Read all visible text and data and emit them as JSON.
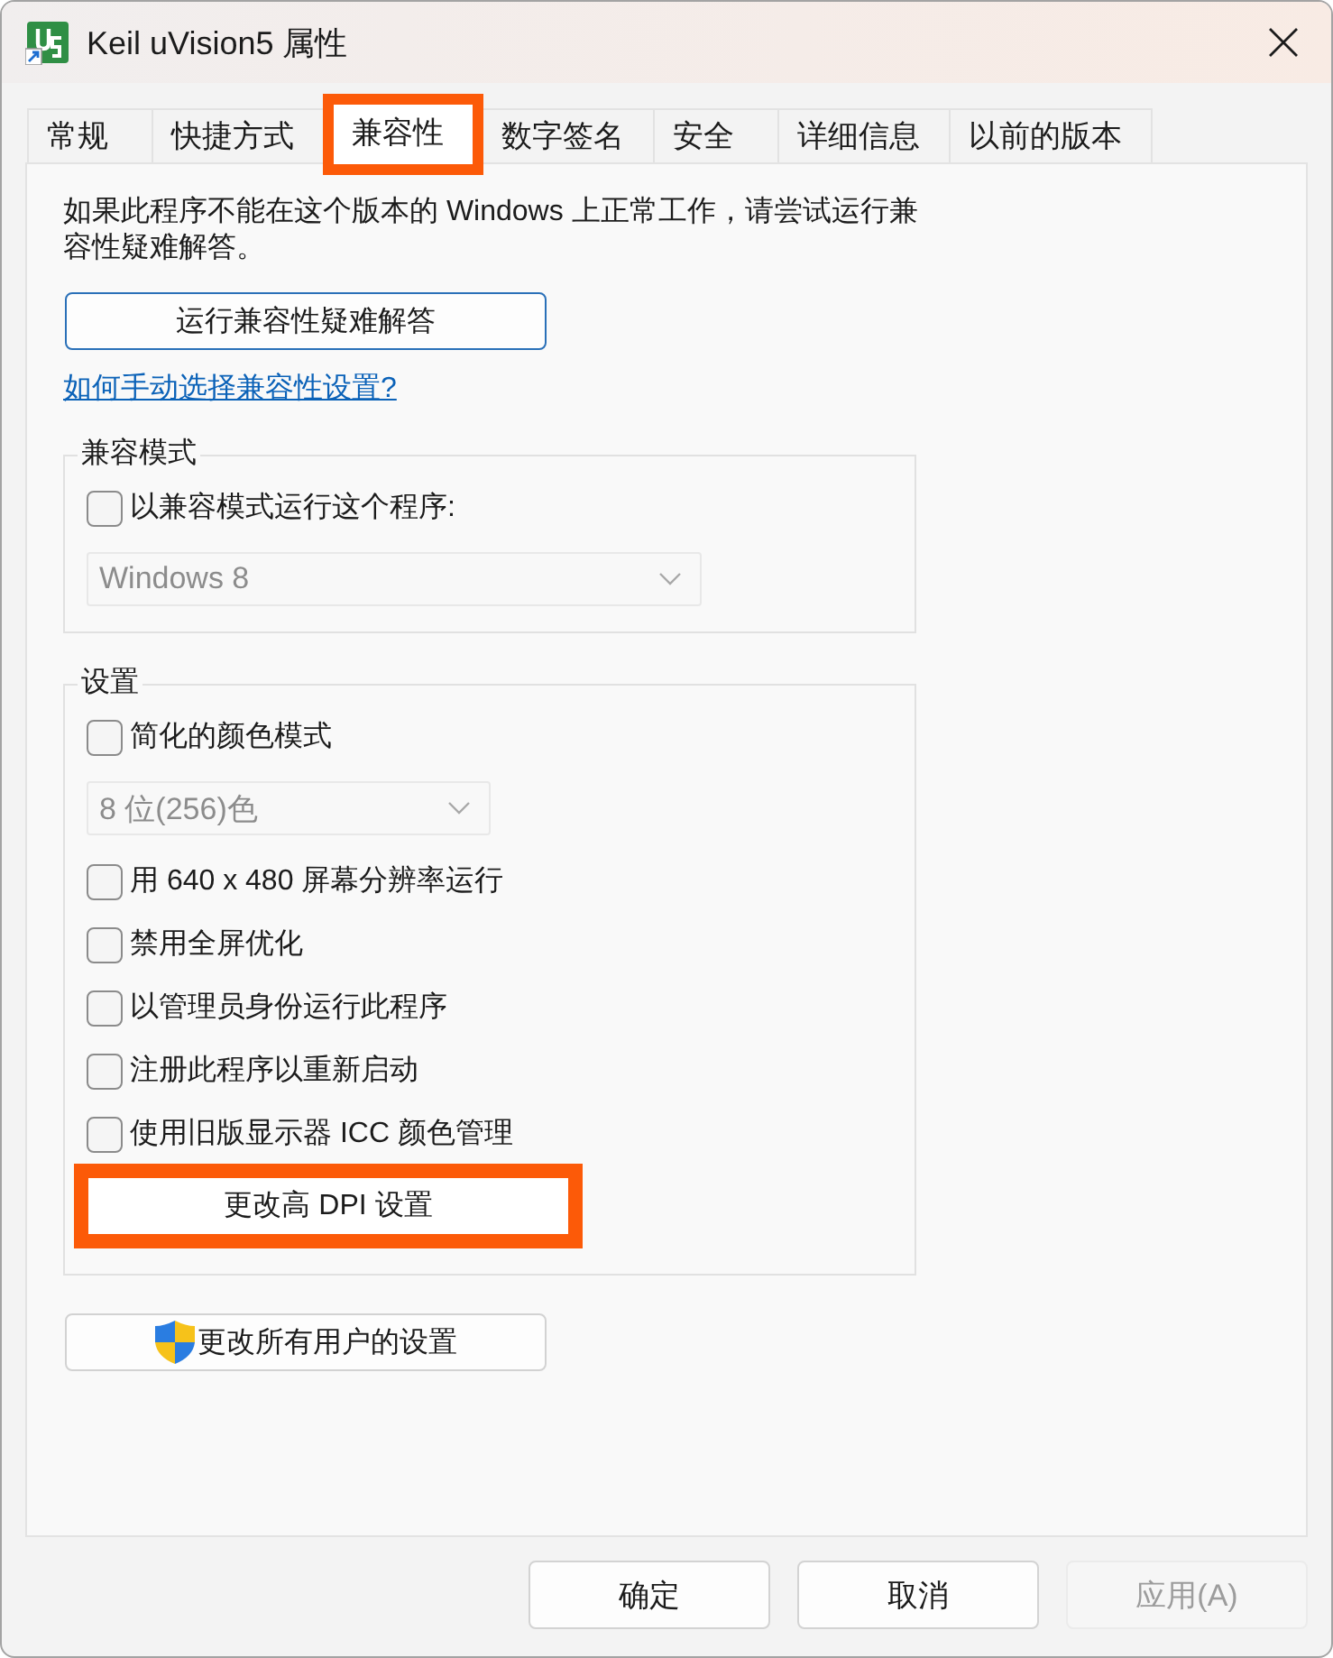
{
  "window": {
    "title": "Keil uVision5 属性"
  },
  "tabs": [
    {
      "label": "常规",
      "selected": false,
      "highlighted": false
    },
    {
      "label": "快捷方式",
      "selected": false,
      "highlighted": false
    },
    {
      "label": "兼容性",
      "selected": true,
      "highlighted": true
    },
    {
      "label": "数字签名",
      "selected": false,
      "highlighted": false
    },
    {
      "label": "安全",
      "selected": false,
      "highlighted": false
    },
    {
      "label": "详细信息",
      "selected": false,
      "highlighted": false
    },
    {
      "label": "以前的版本",
      "selected": false,
      "highlighted": false
    }
  ],
  "intro": "如果此程序不能在这个版本的 Windows 上正常工作，请尝试运行兼容性疑难解答。",
  "troubleshoot_button": {
    "label": "运行兼容性疑难解答",
    "default": true
  },
  "help_link": "如何手动选择兼容性设置?",
  "groups": [
    {
      "title": "兼容模式",
      "items": [
        {
          "kind": "checkbox",
          "label": "以兼容模式运行这个程序:",
          "checked": false
        },
        {
          "kind": "dropdown",
          "value": "Windows 8",
          "disabled": true
        }
      ]
    },
    {
      "title": "设置",
      "items": [
        {
          "kind": "checkbox",
          "label": "简化的颜色模式",
          "checked": false
        },
        {
          "kind": "dropdown",
          "value": "8 位(256)色",
          "disabled": true
        },
        {
          "kind": "checkbox",
          "label": "用 640 x 480 屏幕分辨率运行",
          "checked": false
        },
        {
          "kind": "checkbox",
          "label": "禁用全屏优化",
          "checked": false
        },
        {
          "kind": "checkbox",
          "label": "以管理员身份运行此程序",
          "checked": false
        },
        {
          "kind": "checkbox",
          "label": "注册此程序以重新启动",
          "checked": false
        },
        {
          "kind": "checkbox",
          "label": "使用旧版显示器 ICC 颜色管理",
          "checked": false
        },
        {
          "kind": "button",
          "label": "更改高 DPI 设置",
          "highlighted": true
        }
      ]
    }
  ],
  "all_users_button": {
    "label": "更改所有用户的设置"
  },
  "footer_buttons": [
    {
      "label": "确定",
      "disabled": false
    },
    {
      "label": "取消",
      "disabled": false
    },
    {
      "label": "应用(A)",
      "disabled": true
    }
  ]
}
